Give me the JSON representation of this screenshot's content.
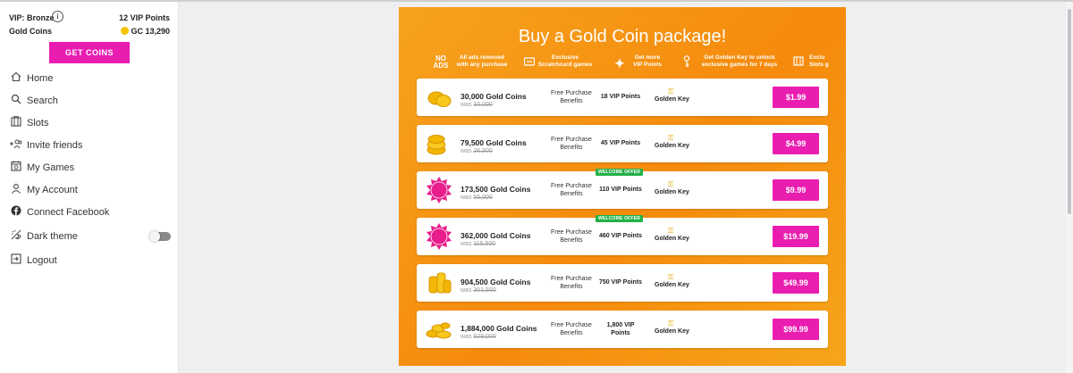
{
  "sidebar": {
    "vip_label": "VIP: Bronze",
    "vip_points": "12 VIP Points",
    "gold_label": "Gold Coins",
    "gold_value": "GC 13,290",
    "get_coins": "GET COINS",
    "items": [
      {
        "label": "Home",
        "icon": "home-icon"
      },
      {
        "label": "Search",
        "icon": "search-icon"
      },
      {
        "label": "Slots",
        "icon": "slots-icon"
      },
      {
        "label": "Invite friends",
        "icon": "invite-icon"
      },
      {
        "label": "My Games",
        "icon": "games-icon"
      },
      {
        "label": "My Account",
        "icon": "account-icon"
      },
      {
        "label": "Connect Facebook",
        "icon": "facebook-icon"
      },
      {
        "label": "Dark theme",
        "icon": "dark-theme-icon"
      },
      {
        "label": "Logout",
        "icon": "logout-icon"
      }
    ]
  },
  "store": {
    "title": "Buy a Gold Coin package!",
    "benefits": [
      {
        "icon_text": "NO ADS",
        "line1": "All ads removed",
        "line2": "with any purchase"
      },
      {
        "icon": "scratchcard-icon",
        "line1": "Exclusive",
        "line2": "Scratchcard games"
      },
      {
        "icon": "sparkle-icon",
        "line1": "Get more",
        "line2": "VIP Points"
      },
      {
        "icon": "key-icon",
        "line1": "Get Golden Key to unlock",
        "line2": "exclusive games for 7 days"
      },
      {
        "icon": "slots-icon",
        "line1": "Exclu",
        "line2": "Slots g"
      }
    ],
    "fpb_line1": "Free Purchase",
    "fpb_line2": "Benefits",
    "was_label": "was",
    "golden_key": "Golden Key",
    "welcome_offer": "WELCOME OFFER",
    "packages": [
      {
        "coins": "30,000 Gold Coins",
        "was": "10,000",
        "vip": "18 VIP Points",
        "price": "$1.99",
        "welcome": false
      },
      {
        "coins": "79,500 Gold Coins",
        "was": "26,500",
        "vip": "45 VIP Points",
        "price": "$4.99",
        "welcome": false
      },
      {
        "coins": "173,500 Gold Coins",
        "was": "55,000",
        "vip": "110 VIP Points",
        "price": "$9.99",
        "welcome": true,
        "badge": "WELCOME OFFER"
      },
      {
        "coins": "362,000 Gold Coins",
        "was": "115,500",
        "vip": "460 VIP Points",
        "price": "$19.99",
        "welcome": true,
        "badge": "WELCOME OFFER"
      },
      {
        "coins": "904,500 Gold Coins",
        "was": "301,500",
        "vip": "750 VIP Points",
        "price": "$49.99",
        "welcome": false
      },
      {
        "coins": "1,884,000 Gold Coins",
        "was": "628,000",
        "vip_line1": "1,800 VIP",
        "vip_line2": "Points",
        "price": "$99.99",
        "welcome": false
      }
    ]
  },
  "colors": {
    "accent": "#e91eb0",
    "panel": "#f7a21e",
    "welcome": "#24b14a"
  }
}
